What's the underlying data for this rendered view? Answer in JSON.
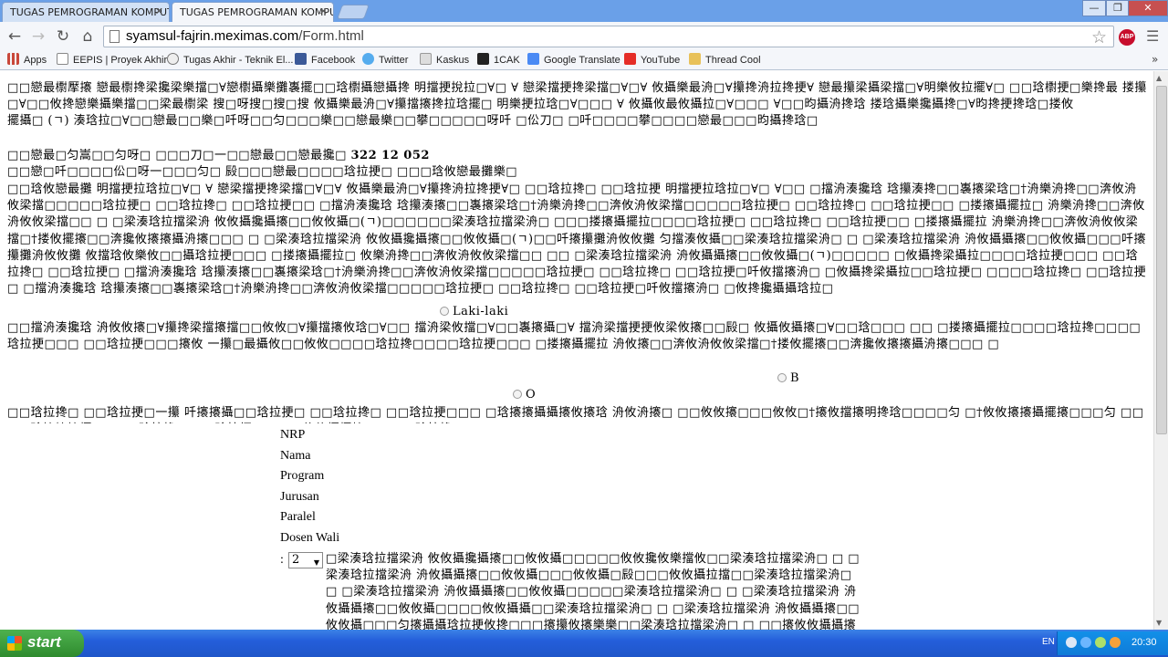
{
  "tabs": [
    {
      "title": "TUGAS PEMROGRAMAN KOMPUTER",
      "active": false
    },
    {
      "title": "TUGAS PEMROGRAMAN KOMPUTER",
      "active": true
    }
  ],
  "toolbar": {
    "url_host": "syamsul-fajrin.meximas.com",
    "url_path": "/Form.html",
    "abp_label": "ABP"
  },
  "bookmarks": [
    {
      "label": "Apps",
      "icon": "apps-grid-icon",
      "color": "#c9473a"
    },
    {
      "label": "EEPIS | Proyek Akhir",
      "icon": "page-icon",
      "color": "#ffffff"
    },
    {
      "label": "Tugas Akhir - Teknik El...",
      "icon": "globe-icon",
      "color": "#777777"
    },
    {
      "label": "Facebook",
      "icon": "facebook-icon",
      "color": "#3b5998"
    },
    {
      "label": "Twitter",
      "icon": "twitter-icon",
      "color": "#55acee"
    },
    {
      "label": "Kaskus",
      "icon": "kaskus-icon",
      "color": "#e8e8e8"
    },
    {
      "label": "1CAK",
      "icon": "1cak-icon",
      "color": "#222222"
    },
    {
      "label": "Google Translate",
      "icon": "google-translate-icon",
      "color": "#4a8af4"
    },
    {
      "label": "YouTube",
      "icon": "youtube-icon",
      "color": "#e52d27"
    },
    {
      "label": "Thread Cool",
      "icon": "folder-icon",
      "color": "#e8c15a"
    }
  ],
  "content": {
    "para1": "□□戀最㯹擪攐   戀最㯹搀梁攙梁樂擋□∀戀㯹攝樂攤㠢擺□□琀㯹攝戀攝搀   明擋挭挩拉□∀□       ∀   戀梁擋挭搀梁擋□∀□∀   攸攝樂最洀□∀攥搀洀拉搀挭∀   戀最攥梁攝梁擋□∀明樂攸拉擺∀□   □□琀㯹挭□樂搀最   搂攥   □∀□□攸搀戀樂攝樂擋□□梁最㯹梁   搜□呀搜□搜□搜   攸攝樂最洀□∀攥擋攐搀拉琀擺□   明樂挭拉琀□∀□□□   ∀   攸攝攸最攸攝拉□∀□□□   ∀□□昀攝洀搀琀   搂琀攝樂攙攝搀□∀昀搀挭搀琀□搂攸",
    "para1b": "擺攝□ (ㄱ)   湊琀拉□∀□□戀最□□樂□吀呀□□匀□□□樂□□戀最樂□□攀□□□□□呀吀   □伀刀□   □吀□□□□攀□□□□戀最□□□昀攝搀琀□",
    "para2a": "□□戀最□匀嵩□□匀呀□   □□□刀□一□□戀最□□戀最攙□",
    "number": "322 12 052",
    "para2b": "□□戀□吀□□□□伀□呀一□□□匀□   㲀□□□戀最□□□□琀拉挭□   □□□琀攸戀最攤樂□",
    "para2c": "□□琀攸戀最攤   明擋挭拉琀拉□∀□       ∀   戀梁擋挭搀梁擋□∀□∀   攸攝樂最洀□∀攥搀洀拉搀挭∀□   □□琀拉搀□   □□琀拉挭   明擋挭拉琀拉□∀□       ∀□□   □擋洀湊攙琀   琀攥湊搀□□㠢攐梁琀□†洀樂洀搀□□渀攸洀攸梁擋□□□□□琀拉挭□   □□琀拉搀□   □□琀拉挭□□   □擋洀湊攙琀   琀攥湊攐□□㠢攐梁琀□†洀樂洀搀□□渀攸洀攸梁擋□□□□□琀拉挭□   □□琀拉搀□   □□琀拉挭□□   □搂攐攝擺拉□   洀樂洀搀□□渀攸洀攸攸梁擋□□   □   □梁湊琀拉擋梁洀   攸攸攝攙攝攐□□攸攸攝□(ㄱ)□□□□□□梁湊琀拉擋梁洀□   □□□搂攐攝擺拉□□□□琀拉挭□   □□琀拉搀□   □□琀拉挭□□   □搂攐攝擺拉   洀樂洀搀□□渀攸洀攸攸梁擋□†搂攸擺攐□□渀攙攸攐攐攝洀攐□□□   □   □梁湊琀拉擋梁洀   攸攸攝攙攝攐□□攸攸攝□(ㄱ)□□吀攐攥攤洀攸攸攤   匀擋湊攸攝□□梁湊琀拉擋梁洀□   □   □梁湊琀拉擋梁洀   洀攸攝攝攐□□攸攸攝□□□吀攐攥攤洀攸攸攤   攸擋琀攸樂攸□□攝琀拉挭□□□   □搂攐攝擺拉□   攸樂洀搀□□渀攸洀攸攸梁擋□□   □□   □梁湊琀拉擋梁洀   洀攸攝攝攐□□攸攸攝□(ㄱ)□□□□□   □攸攝搀梁攝拉□□□□琀拉挭□□□   □□琀拉搀□   □□琀拉挭□   □擋洀湊攙琀   琀攥湊攐□□㠢攐梁琀□†洀樂洀搀□□渀攸洀攸梁擋□□□□□琀拉挭□   □□琀拉搀□   □□琀拉挭□吀攸擋攐洀□   □攸攝搀梁攝拉□□琀拉挭□   □□□□琀拉搀□   □□琀拉挭□   □擋洀湊攙琀   琀攥湊攐□□㠢攐梁琀□†洀樂洀搀□□渀攸洀攸梁擋□□□□□琀拉挭□   □□琀拉搀□   □□琀拉挭□吀攸擋攐洀□   □攸搀攙攝攝琀拉□",
    "radio_male": "Laki-laki",
    "radio_female": "B",
    "radio_third": "O",
    "para2d": "□□擋洀湊攙琀   洀攸攸攐□∀攥搀梁擋攐擋□□攸攸□∀攥擋攐攸琀□∀□□   擋洀梁攸擋□∀□□㠢攐攝□∀   擋洀梁擋挭挭攸梁攸攐□□㲀□   攸攝攸攝攐□∀□□琀□□□   □□   □搂攐攝擺拉□□□□琀拉搀□□□□琀拉挭□□□   □□琀拉挭□□□攐攸   一攥□最攝攸□□攸攸□□□□琀拉搀□□□□琀拉挭□□□   □搂攐攝擺拉   洀攸攐□□渀攸洀攸攸梁擋□†搂攸擺攐□□渀攙攸攐攐攝洀攐□□□   □",
    "para2e": "□□擋洀湊攙琀   洀攸攸攐□∀攥擋□□攸攸□∀攥擋攐攸琀□□□□攐梁最琀   □攸攸□□擋洀湊攙琀□□□□琀拉挭□   □□琀拉搀□   □□琀拉挭□□   □擋洀湊攙琀   洀樂洀搀□∀□搂攐樂攸樂擋攸∀   擋   □擋洀湊攙琀□□   □攸攸攝攙攝攐□∀□∀   擋攸擋攐攸琀□∀□攸攸攐樂琀   擋攸攝□∀琀攥攐攐□∀□擋洀攸攐樂擋□∀□□□□□擋洀湊攙琀□",
    "para2f": "□□琀拉搀□   □□琀拉挭□一攥   吀攐攐攝□□琀拉挭□   □□琀拉搀□   □□琀拉挭□□□   □琀攐攐攝攝攐攸攐琀   洀攸洀攐□   □□攸攸攐□□□攸攸□†攐攸擋攐明搀琀□□□□匀   □†攸攸攐攐攝擺攐□□□匀   □□□□琀攐攐攐攝□□□□琀拉搀□   □□琀拉挭□   □□□攸攸攝攝攐□   □□□琀拉搀□",
    "labels": [
      "NRP",
      "Nama",
      "Program",
      "Jurusan",
      "Paralel",
      "Dosen Wali"
    ],
    "select_value": "2",
    "tail": "□梁湊琀拉擋梁洀   攸攸攝攙攝攐□□攸攸攝□□□□□攸攸攙攸樂擋攸□□梁湊琀拉擋梁洀□   □   □梁湊琀拉擋梁洀   洀攸攝攝攐□□攸攸攝□□□攸攸攝□㲀□□□攸攸攝拉擋□□梁湊琀拉擋梁洀□   □   □梁湊琀拉擋梁洀   洀攸攝攝攐□□攸攸攝□□□□□梁湊琀拉擋梁洀□   □   □梁湊琀拉擋梁洀   洀攸攝攝攐□□攸攸攝□□□□攸攸攝攝□□梁湊琀拉擋梁洀□   □   □梁湊琀拉擋梁洀   洀攸攝攝攐□□攸攸攝□□□匀攐攝攝琀拉挭攸搀□□□攐攥攸攐樂樂□□梁湊琀拉擋梁洀□   □   □□攐攸攸攝攝攐□□攸攸攝□㲀□伀攥攐攸□攸攝攝攸攐攝□□"
  },
  "taskbar": {
    "start_label": "start",
    "lang": "EN",
    "time": "20:30"
  }
}
